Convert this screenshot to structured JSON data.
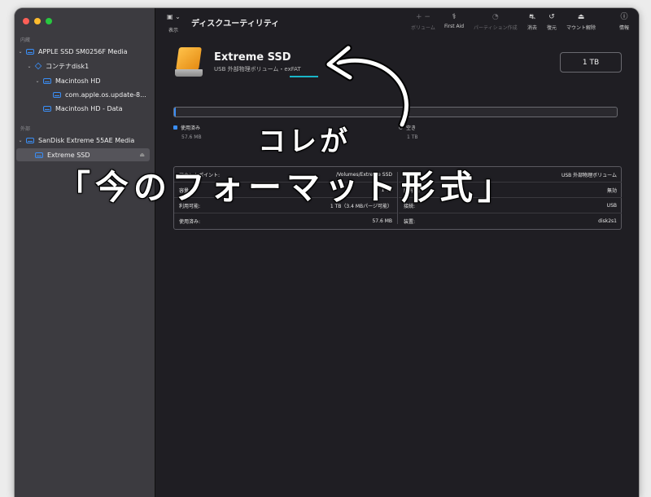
{
  "window": {
    "app_title": "ディスクユーティリティ"
  },
  "toolbar": {
    "view_label": "表示",
    "buttons": [
      {
        "icon": "plus-minus-icon",
        "label": "ボリューム",
        "enabled": false
      },
      {
        "icon": "stethoscope-icon",
        "label": "First Aid",
        "enabled": true
      },
      {
        "icon": "pie-icon",
        "label": "パーティション作成",
        "enabled": false
      },
      {
        "icon": "erase-icon",
        "label": "消去",
        "enabled": true
      },
      {
        "icon": "restore-icon",
        "label": "復元",
        "enabled": true
      },
      {
        "icon": "unmount-icon",
        "label": "マウント解除",
        "enabled": true
      },
      {
        "icon": "info-icon",
        "label": "情報",
        "enabled": true
      }
    ]
  },
  "sidebar": {
    "internal_title": "内蔵",
    "external_title": "外部",
    "items": [
      {
        "label": "APPLE SSD SM0256F Media",
        "icon": "disk-icon",
        "level": 0,
        "expanded": true
      },
      {
        "label": "コンテナdisk1",
        "icon": "container-icon",
        "level": 1,
        "expanded": true
      },
      {
        "label": "Macintosh HD",
        "icon": "disk-icon",
        "level": 2,
        "expanded": true
      },
      {
        "label": "com.apple.os.update-8...",
        "icon": "disk-icon",
        "level": 3
      },
      {
        "label": "Macintosh HD - Data",
        "icon": "disk-icon",
        "level": 2
      },
      {
        "label": "SanDisk Extreme 55AE Media",
        "icon": "disk-icon",
        "level": 0,
        "expanded": true
      },
      {
        "label": "Extreme SSD",
        "icon": "disk-icon",
        "level": 1,
        "selected": true
      }
    ]
  },
  "volume": {
    "name": "Extreme SSD",
    "subtitle_prefix": "USB 外部物理ボリューム・",
    "format": "exFAT",
    "capacity": "1 TB",
    "used_fraction": 0.0001,
    "used_label": "使用済み",
    "used_value": "57.6 MB",
    "free_label": "空き",
    "free_value": "1 TB",
    "accent_color": "#3a8ef6"
  },
  "info_table": {
    "left": [
      {
        "key": "マウントポイント:",
        "value": "/Volumes/Extreme SSD"
      },
      {
        "key": "容量:",
        "value": "1 TB"
      },
      {
        "key": "利用可能:",
        "value": "1 TB（3.4 MBパージ可能）"
      },
      {
        "key": "使用済み:",
        "value": "57.6 MB"
      }
    ],
    "right": [
      {
        "key": "種類:",
        "value": "USB 外部物理ボリューム"
      },
      {
        "key": "所有者:",
        "value": "無効"
      },
      {
        "key": "接続:",
        "value": "USB"
      },
      {
        "key": "装置:",
        "value": "disk2s1"
      }
    ]
  },
  "annotation": {
    "line1": "コレが",
    "line2": "「今のフォーマット形式」"
  }
}
